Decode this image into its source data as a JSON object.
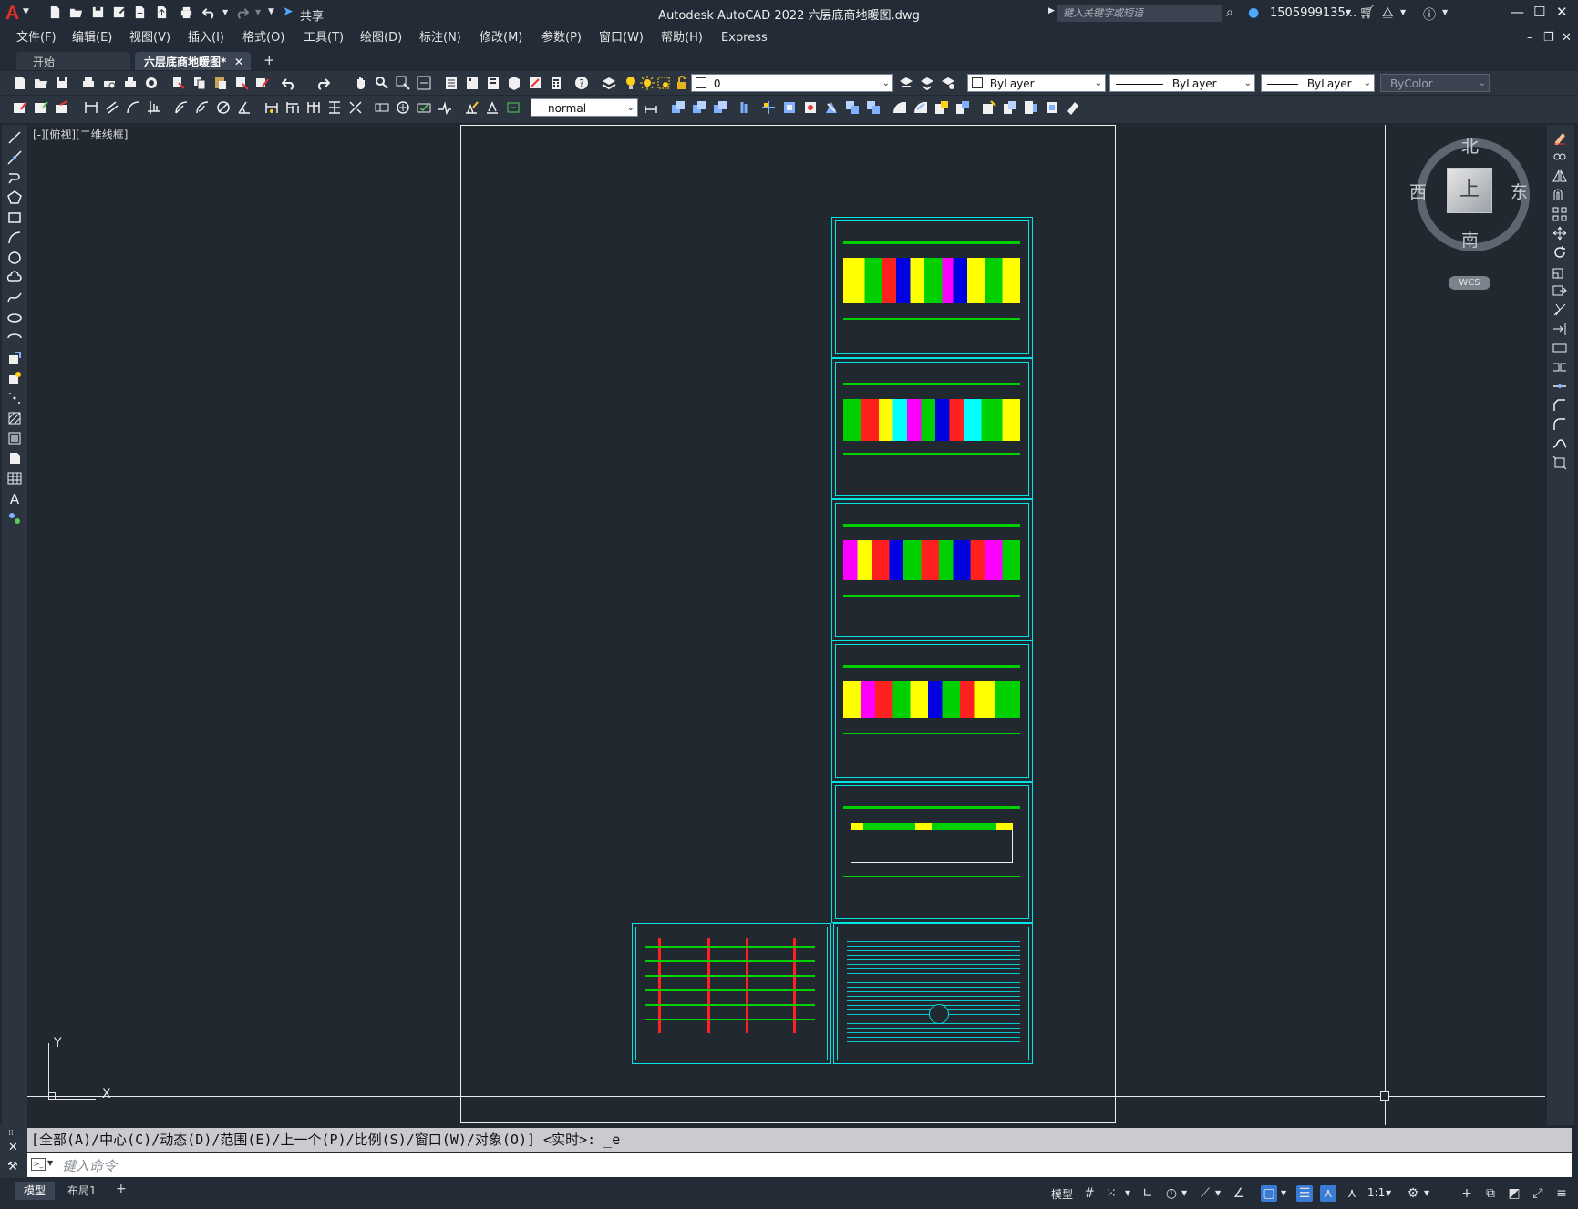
{
  "app": {
    "title": "Autodesk AutoCAD 2022    六层底商地暖图.dwg",
    "share_label": "共享",
    "search_placeholder": "键入关键字或短语",
    "user": "1505999135...",
    "accent": "#e0302d"
  },
  "menubar": {
    "items": [
      "文件(F)",
      "编辑(E)",
      "视图(V)",
      "插入(I)",
      "格式(O)",
      "工具(T)",
      "绘图(D)",
      "标注(N)",
      "修改(M)",
      "参数(P)",
      "窗口(W)",
      "帮助(H)",
      "Express"
    ]
  },
  "tabs": {
    "start": "开始",
    "doc": "六层底商地暖图*",
    "close": "✕",
    "new": "+"
  },
  "toolbar": {
    "layer_value": "0",
    "color_value": "ByLayer",
    "linetype_value": "ByLayer",
    "lineweight_value": "ByLayer",
    "plotstyle_value": "ByColor",
    "textstyle_value": "normal"
  },
  "viewport": {
    "label": "[-][俯视][二维线框]",
    "axis_y": "Y",
    "axis_x": "X"
  },
  "viewcube": {
    "north": "北",
    "south": "南",
    "east": "东",
    "west": "西",
    "top_face": "上",
    "wcs": "WCS"
  },
  "command": {
    "history": "[全部(A)/中心(C)/动态(D)/范围(E)/上一个(P)/比例(S)/窗口(W)/对象(O)] <实时>: _e",
    "placeholder": "键入命令"
  },
  "statusbar": {
    "model_tab": "模型",
    "layout_tab": "布局1",
    "add": "+",
    "model_label": "模型",
    "scale": "1:1"
  },
  "colors": {
    "sheet_border": "#00e5e5",
    "drawing_bg": "#212830",
    "room_red": "#ff2020",
    "room_yellow": "#ffff00",
    "room_green": "#00d000",
    "room_blue": "#0000e0",
    "room_magenta": "#ff00ff",
    "room_cyan": "#00ffff"
  }
}
